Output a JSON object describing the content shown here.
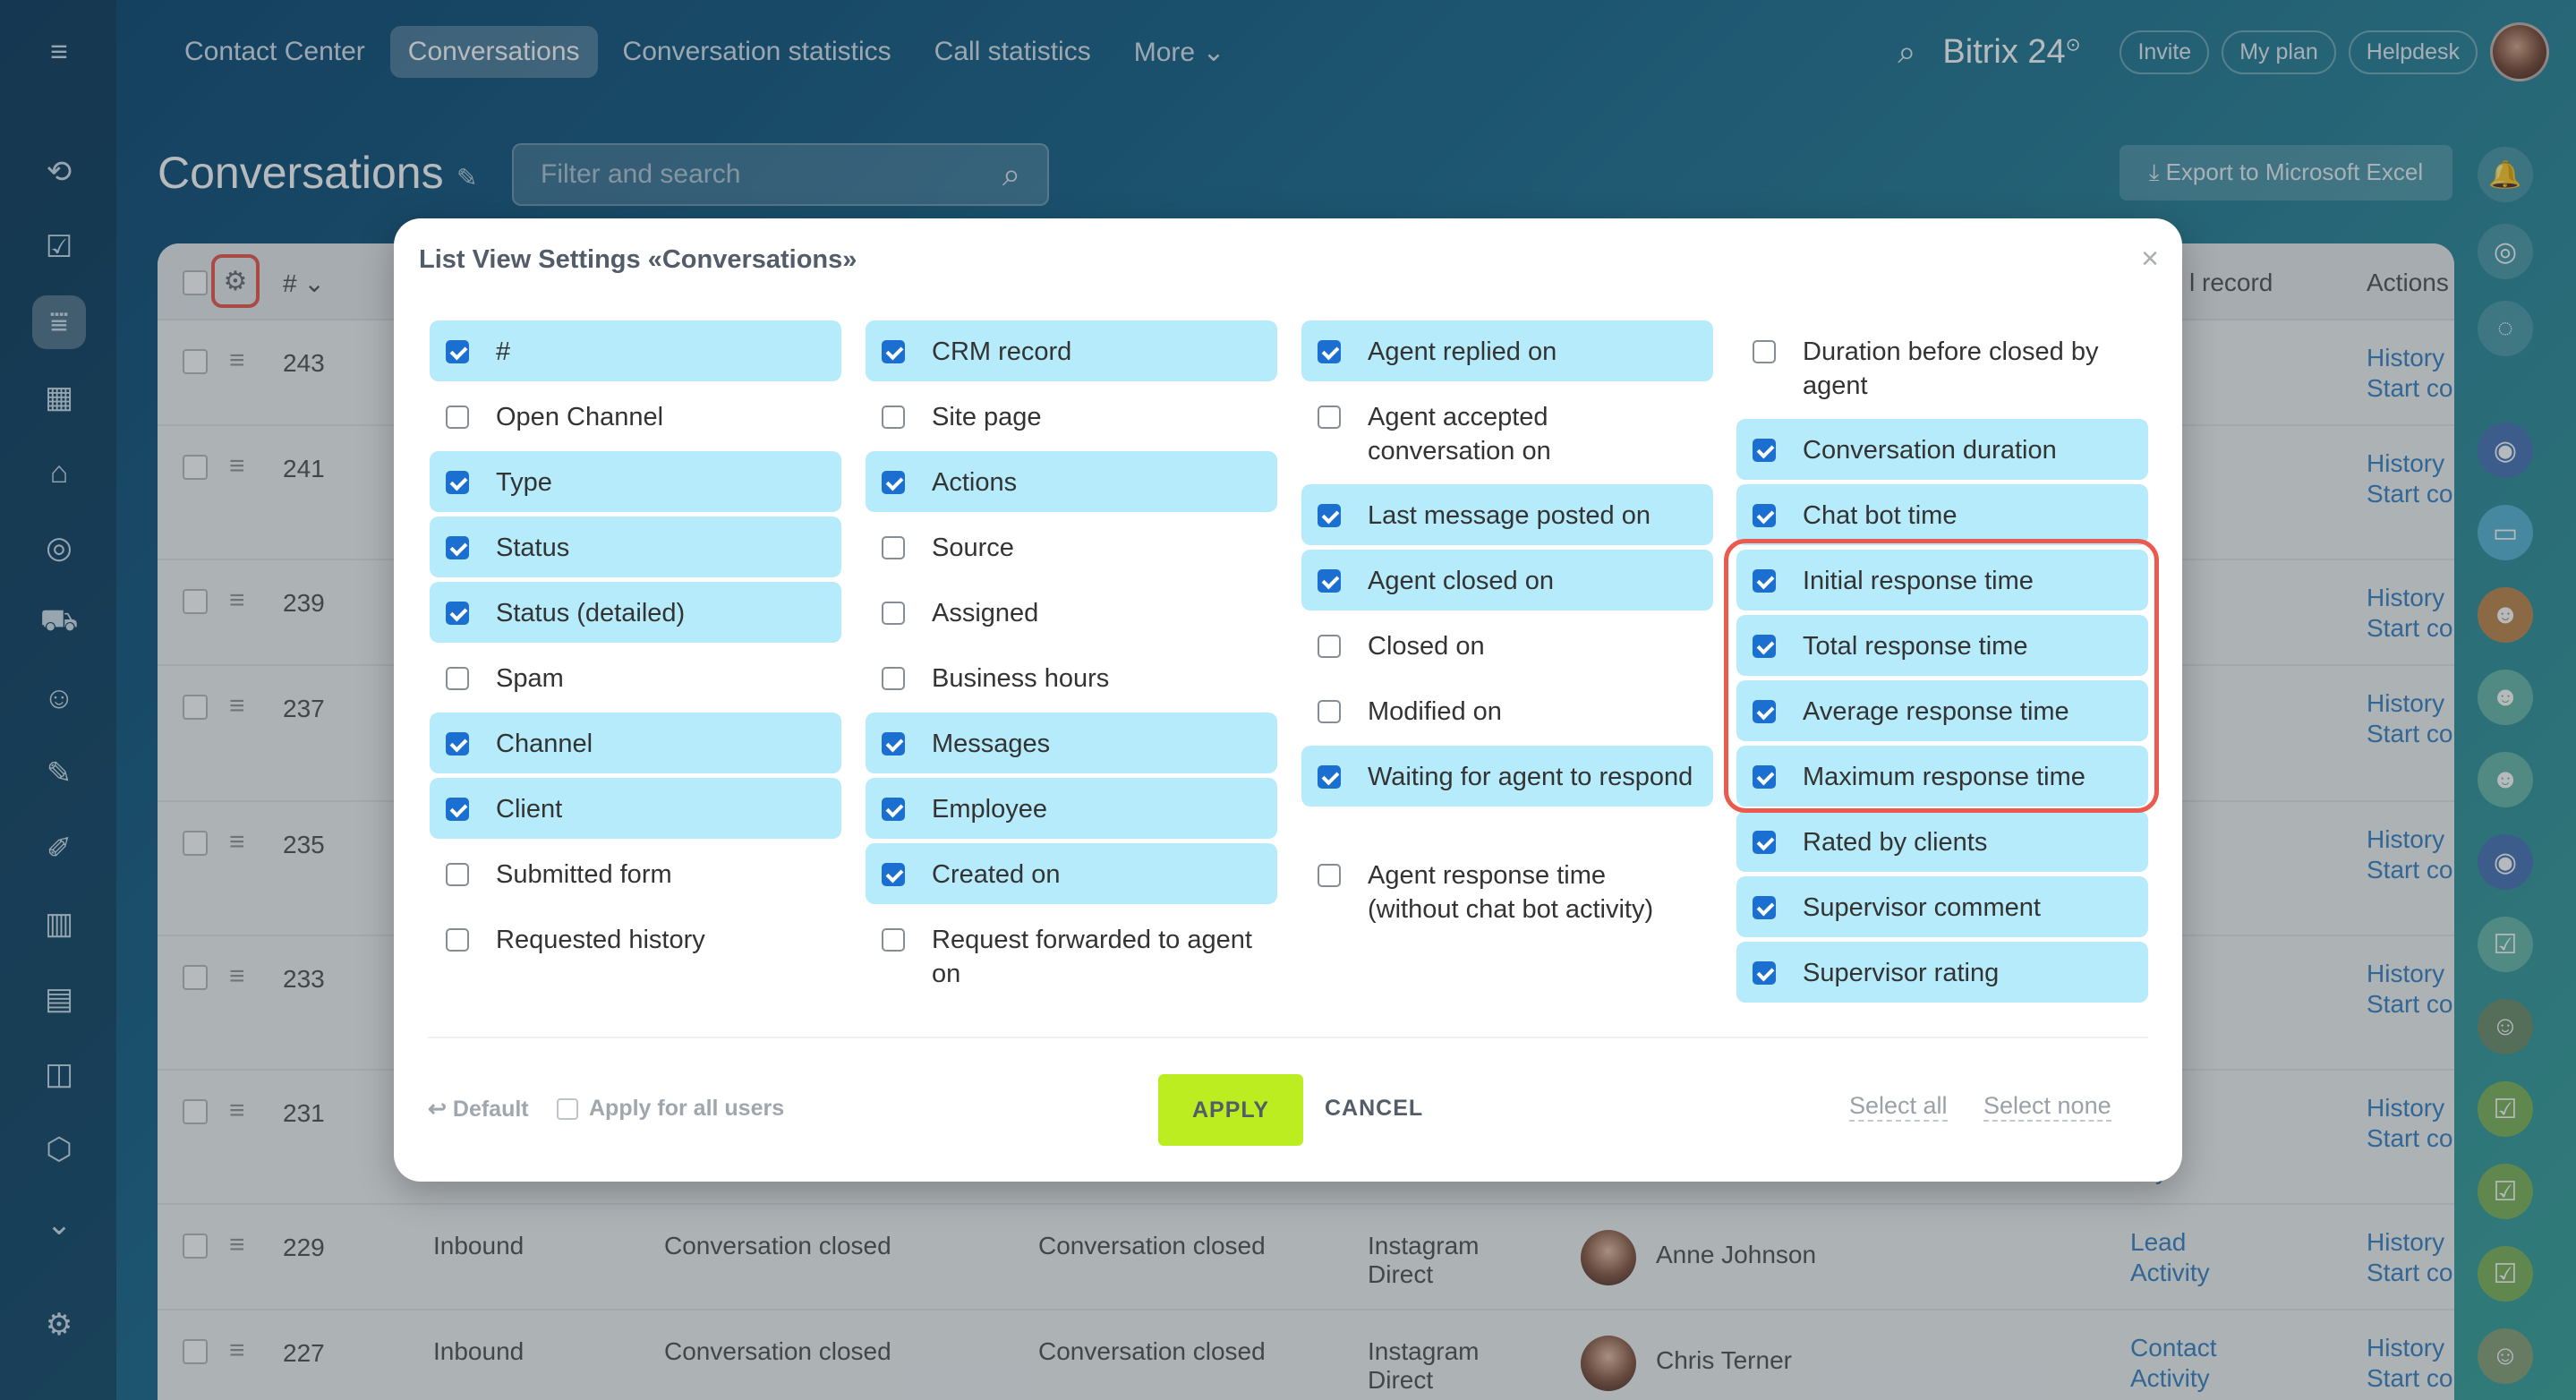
{
  "top_bar": {
    "tabs": [
      {
        "label": "Contact Center",
        "active": false
      },
      {
        "label": "Conversations",
        "active": true
      },
      {
        "label": "Conversation statistics",
        "active": false
      },
      {
        "label": "Call statistics",
        "active": false
      },
      {
        "label": "More ⌄",
        "active": false
      }
    ],
    "brand": "Bitrix 24",
    "brand_badge": "⊙",
    "invite": "Invite",
    "my_plan": "My plan",
    "helpdesk": "Helpdesk"
  },
  "page": {
    "title": "Conversations",
    "filter_placeholder": "Filter and search",
    "export_label": "⤓  Export to Microsoft Excel"
  },
  "table": {
    "hash_header": "# ⌄",
    "crm_header": "l record",
    "actions_header": "Actions",
    "rows": [
      {
        "num": "243",
        "crm1": "d",
        "crm2": "vity",
        "hist1": "History",
        "hist2": "Start co"
      },
      {
        "num": "241",
        "crm1": "d",
        "crm2": "tact",
        "hist1": "History",
        "hist2": "Start co"
      },
      {
        "num": "239",
        "crm1": "d",
        "crm2": "vity",
        "hist1": "History",
        "hist2": "Start co"
      },
      {
        "num": "237",
        "crm1": "tact",
        "crm2": "vity",
        "hist1": "History",
        "hist2": "Start co"
      },
      {
        "num": "235",
        "crm1": "tact",
        "crm2": "vity",
        "hist1": "History",
        "hist2": "Start co"
      },
      {
        "num": "233",
        "crm1": "tact",
        "crm2": "vity",
        "hist1": "History",
        "hist2": "Start co"
      },
      {
        "num": "231",
        "crm1": "d",
        "crm2": "vity",
        "hist1": "History",
        "hist2": "Start co"
      },
      {
        "num": "229",
        "type": "Inbound",
        "status": "Conversation closed",
        "status_detailed": "Conversation closed",
        "channel1": "Instagram",
        "channel2": "Direct",
        "name": "Anne Johnson",
        "crm1": "Lead",
        "crm2": "Activity",
        "hist1": "History",
        "hist2": "Start co"
      },
      {
        "num": "227",
        "type": "Inbound",
        "status": "Conversation closed",
        "status_detailed": "Conversation closed",
        "channel1": "Instagram",
        "channel2": "Direct",
        "name": "Chris Terner",
        "crm1": "Contact",
        "crm2": "Activity",
        "hist1": "History",
        "hist2": "Start co"
      }
    ]
  },
  "modal": {
    "title": "List View Settings «Conversations»",
    "close": "×",
    "columns": [
      [
        {
          "label": "#",
          "checked": true
        },
        {
          "label": "Open Channel",
          "checked": false
        },
        {
          "label": "Type",
          "checked": true
        },
        {
          "label": "Status",
          "checked": true
        },
        {
          "label": "Status (detailed)",
          "checked": true
        },
        {
          "label": "Spam",
          "checked": false
        },
        {
          "label": "Channel",
          "checked": true
        },
        {
          "label": "Client",
          "checked": true
        },
        {
          "label": "Submitted form",
          "checked": false
        },
        {
          "label": "Requested history",
          "checked": false
        }
      ],
      [
        {
          "label": "CRM record",
          "checked": true
        },
        {
          "label": "Site page",
          "checked": false
        },
        {
          "label": "Actions",
          "checked": true
        },
        {
          "label": "Source",
          "checked": false
        },
        {
          "label": "Assigned",
          "checked": false
        },
        {
          "label": "Business hours",
          "checked": false
        },
        {
          "label": "Messages",
          "checked": true
        },
        {
          "label": "Employee",
          "checked": true
        },
        {
          "label": "Created on",
          "checked": true
        },
        {
          "label": "Request forwarded to agent on",
          "checked": false
        }
      ],
      [
        {
          "label": "Agent replied on",
          "checked": true
        },
        {
          "label": "Agent accepted conversation on",
          "checked": false
        },
        {
          "label": "Last message posted on",
          "checked": true
        },
        {
          "label": "Agent closed on",
          "checked": true
        },
        {
          "label": "Closed on",
          "checked": false
        },
        {
          "label": "Modified on",
          "checked": false
        },
        {
          "label": "Waiting for agent to respond",
          "checked": true
        },
        {
          "label": "Agent response time (without chat bot activity)",
          "checked": false
        }
      ],
      [
        {
          "label": "Duration before closed by agent",
          "checked": false
        },
        {
          "label": "Conversation duration",
          "checked": true
        },
        {
          "label": "Chat bot time",
          "checked": true
        },
        {
          "label": "Initial response time",
          "checked": true
        },
        {
          "label": "Total response time",
          "checked": true
        },
        {
          "label": "Average response time",
          "checked": true
        },
        {
          "label": "Maximum response time",
          "checked": true
        },
        {
          "label": "Rated by clients",
          "checked": true
        },
        {
          "label": "Supervisor comment",
          "checked": true
        },
        {
          "label": "Supervisor rating",
          "checked": true
        }
      ]
    ],
    "footer": {
      "default": "↩ Default",
      "apply_all": "Apply for all users",
      "apply": "APPLY",
      "cancel": "CANCEL",
      "select_all": "Select all",
      "select_none": "Select none"
    }
  },
  "colors": {
    "checked_row": "#b5ebfa",
    "checkbox": "#1a6fd1",
    "apply_button": "#bbed21",
    "highlight": "#ea5a4f",
    "link": "#3c84c4"
  }
}
